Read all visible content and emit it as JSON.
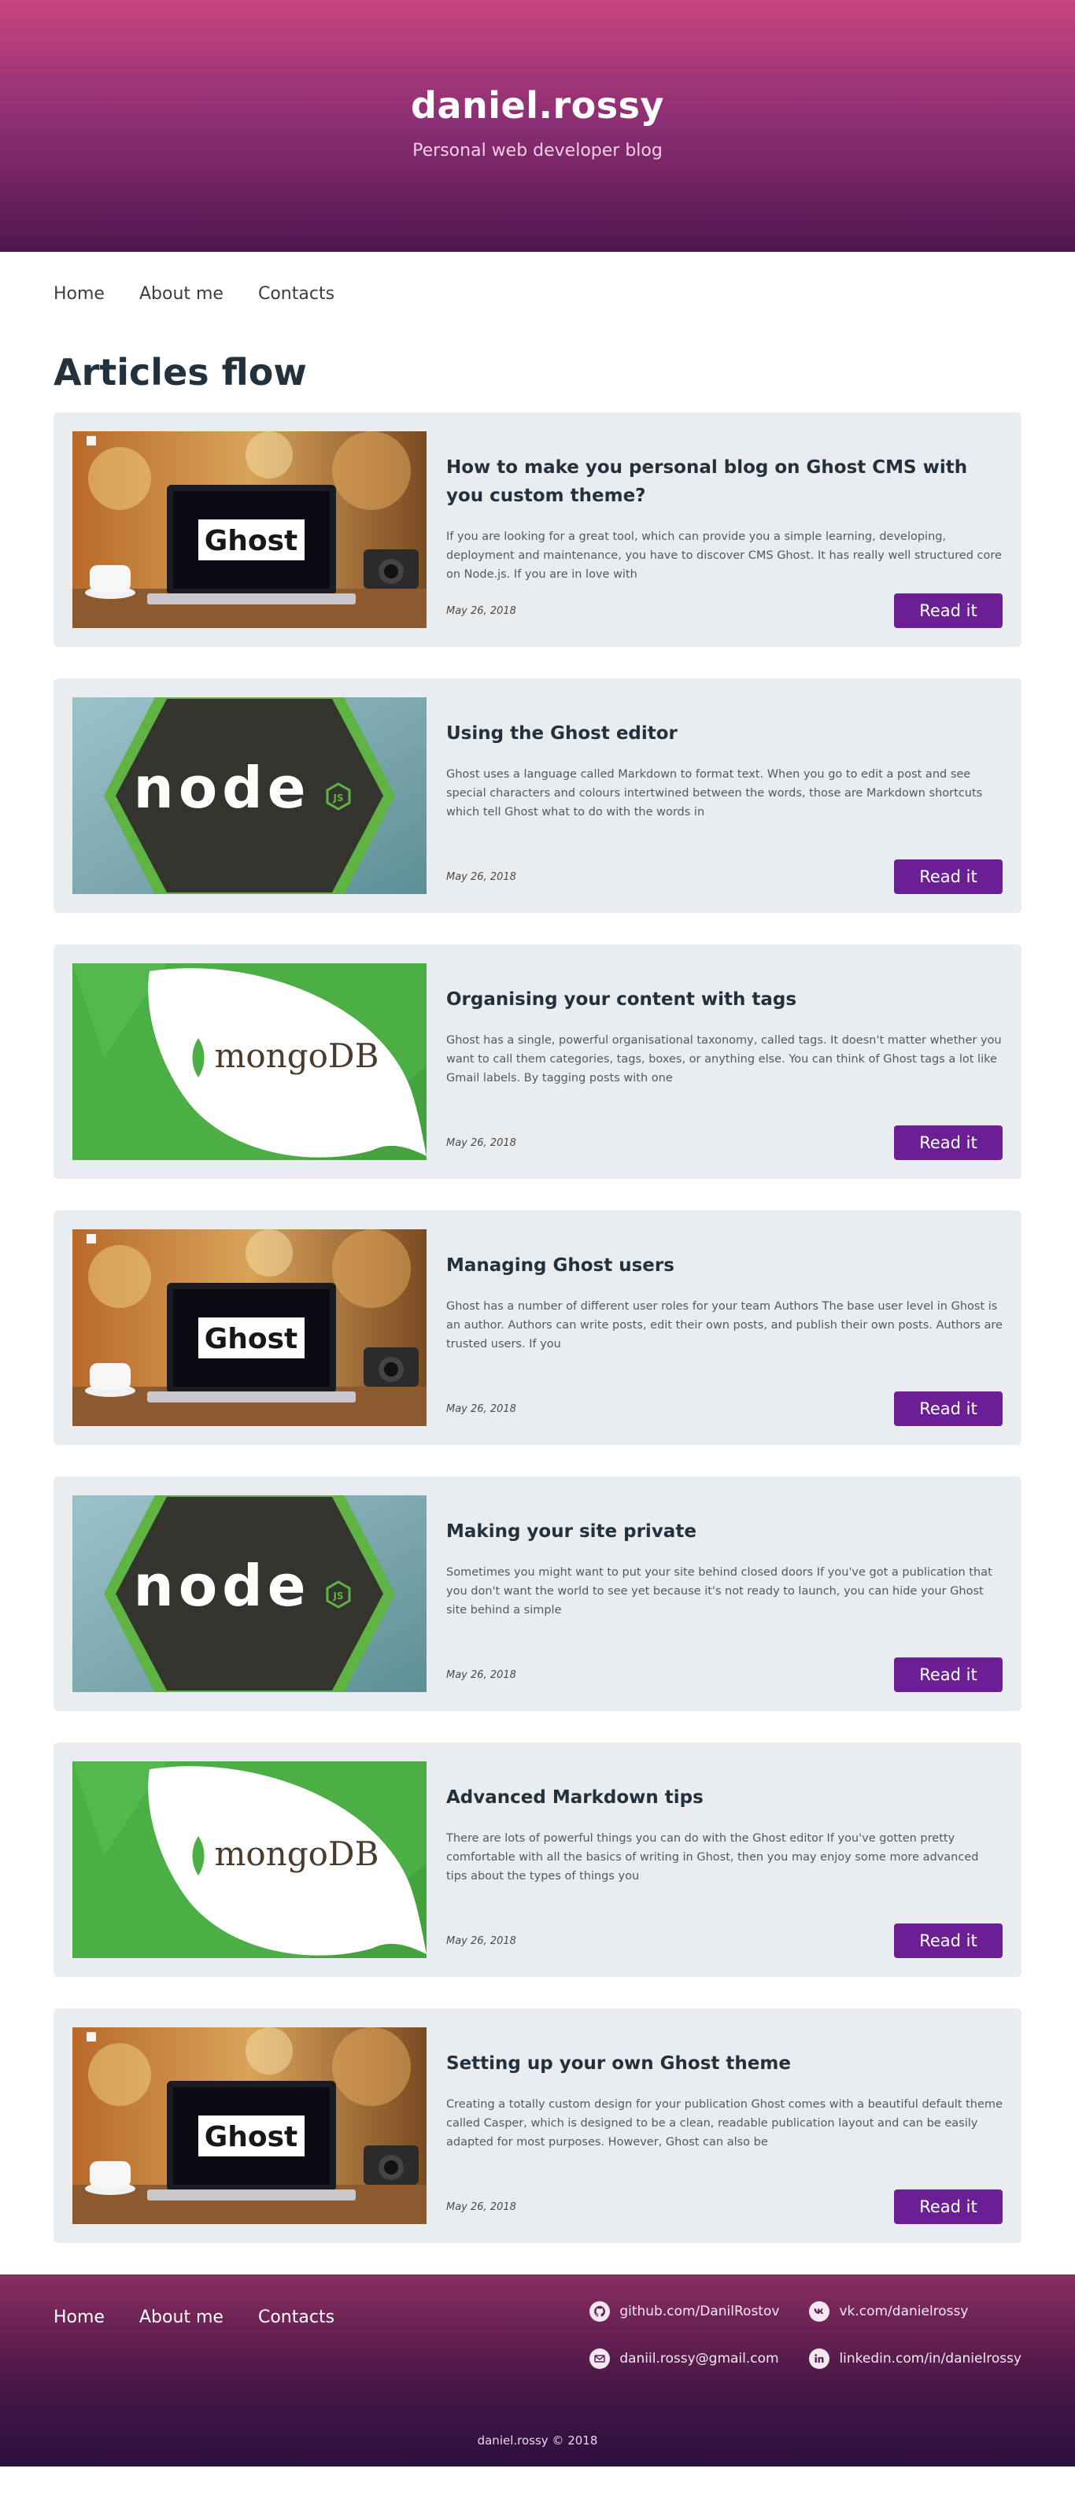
{
  "header": {
    "title": "daniel.rossy",
    "subtitle": "Personal web developer blog"
  },
  "nav": [
    {
      "label": "Home"
    },
    {
      "label": "About me"
    },
    {
      "label": "Contacts"
    }
  ],
  "page": {
    "title": "Articles flow"
  },
  "images": {
    "ghost": {
      "logo_text": "Ghost"
    },
    "node": {
      "logo_text": "node",
      "badge": "JS"
    },
    "mongo": {
      "logo_text": "mongoDB"
    }
  },
  "articles": [
    {
      "image": "ghost",
      "title": "How to make you personal blog on Ghost CMS with you custom theme?",
      "excerpt": "If you are looking for a great tool, which can provide you a simple learning, developing, deployment and maintenance, you have to discover CMS Ghost. It has really well structured core on Node.js. If you are in love with",
      "date": "May 26, 2018",
      "button": "Read it"
    },
    {
      "image": "node",
      "title": "Using the Ghost editor",
      "excerpt": "Ghost uses a language called Markdown to format text. When you go to edit a post and see special characters and colours intertwined between the words, those are Markdown shortcuts which tell Ghost what to do with the words in",
      "date": "May 26, 2018",
      "button": "Read it"
    },
    {
      "image": "mongo",
      "title": "Organising your content with tags",
      "excerpt": "Ghost has a single, powerful organisational taxonomy, called tags. It doesn't matter whether you want to call them categories, tags, boxes, or anything else. You can think of Ghost tags a lot like Gmail labels. By tagging posts with one",
      "date": "May 26, 2018",
      "button": "Read it"
    },
    {
      "image": "ghost",
      "title": "Managing Ghost users",
      "excerpt": "Ghost has a number of different user roles for your team Authors The base user level in Ghost is an author. Authors can write posts, edit their own posts, and publish their own posts. Authors are trusted users. If you",
      "date": "May 26, 2018",
      "button": "Read it"
    },
    {
      "image": "node",
      "title": "Making your site private",
      "excerpt": "Sometimes you might want to put your site behind closed doors If you've got a publication that you don't want the world to see yet because it's not ready to launch, you can hide your Ghost site behind a simple",
      "date": "May 26, 2018",
      "button": "Read it"
    },
    {
      "image": "mongo",
      "title": "Advanced Markdown tips",
      "excerpt": "There are lots of powerful things you can do with the Ghost editor If you've gotten pretty comfortable with all the basics of writing in Ghost, then you may enjoy some more advanced tips about the types of things you",
      "date": "May 26, 2018",
      "button": "Read it"
    },
    {
      "image": "ghost",
      "title": "Setting up your own Ghost theme",
      "excerpt": "Creating a totally custom design for your publication Ghost comes with a beautiful default theme called Casper, which is designed to be a clean, readable publication layout and can be easily adapted for most purposes. However, Ghost can also be",
      "date": "May 26, 2018",
      "button": "Read it"
    }
  ],
  "footer": {
    "nav": [
      {
        "label": "Home"
      },
      {
        "label": "About me"
      },
      {
        "label": "Contacts"
      }
    ],
    "contacts": [
      {
        "icon": "github-icon",
        "label": "github.com/DanilRostov"
      },
      {
        "icon": "vk-icon",
        "label": "vk.com/danielrossy"
      },
      {
        "icon": "email-icon",
        "label": "daniil.rossy@gmail.com"
      },
      {
        "icon": "linkedin-icon",
        "label": "linkedin.com/in/danielrossy"
      }
    ],
    "copyright": "daniel.rossy © 2018"
  },
  "colors": {
    "accent": "#6c1f94",
    "card_bg": "#eaedf0",
    "header_top": "#c8457f",
    "header_bottom": "#4f1650"
  }
}
